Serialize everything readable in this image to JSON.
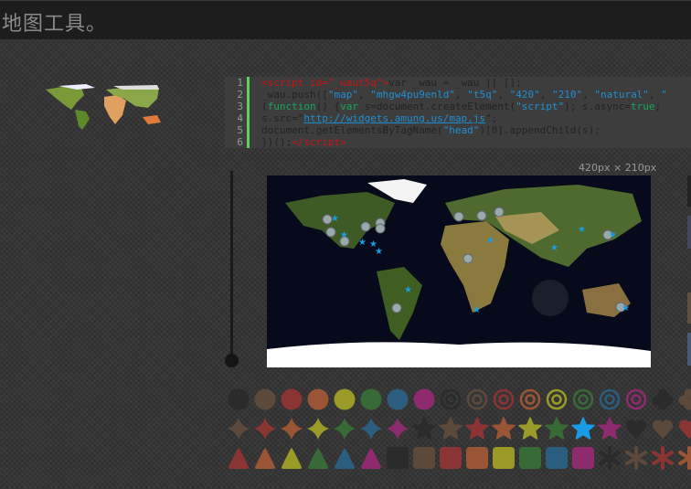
{
  "header": {
    "title": "地图工具。"
  },
  "code": {
    "line_numbers": [
      "1",
      "2",
      "3",
      "4",
      "5",
      "6"
    ],
    "l1_tag": "<script id=\"_waut5q\">",
    "l1_rest": "var _wau = _wau || [];",
    "l2_a": "_wau.push([",
    "l2_s1": "\"map\"",
    "l2_s2": "\"mhgw4pu9enld\"",
    "l2_s3": "\"t5q\"",
    "l2_s4": "\"420\"",
    "l2_s5": "\"210\"",
    "l2_s6": "\"natural\"",
    "l2_s7": "\"",
    "l3_kw1": "function",
    "l3_kw2": "var",
    "l3_a": " s=document.createElement(",
    "l3_s": "\"script\"",
    "l3_b": "); s.async=",
    "l3_kw3": "true",
    "l4_a": "s.src=",
    "l4_url": "http://widgets.amung.us/map.js",
    "l5_a": "document.getElementsByTagName(",
    "l5_s": "\"head\"",
    "l5_b": ")[0].appendChild(s);",
    "l6_a": "})();",
    "l6_tag": "</script>"
  },
  "preview": {
    "size_label": "420px × 210px"
  },
  "slider": {
    "value": 0
  },
  "colors": [
    "#2b2b2b",
    "#5b4a3c",
    "#8a3434",
    "#9a5535",
    "#9a9a28",
    "#386a38",
    "#2b5d7e",
    "#8e2a6e"
  ],
  "selected_marker": {
    "shape": "star",
    "color": "#1a9be6"
  },
  "marker_rows": [
    {
      "shape": "circle",
      "colors": [
        0,
        1,
        2,
        3,
        4,
        5,
        6,
        7
      ]
    },
    {
      "shape": "ring",
      "colors": [
        0,
        1,
        2,
        3,
        4,
        5,
        6,
        7
      ]
    },
    {
      "shape": "club",
      "colors": [
        0,
        1
      ]
    },
    {
      "shape": "diamond",
      "colors": [
        1,
        2,
        3,
        4,
        5,
        6,
        7
      ]
    },
    {
      "shape": "star",
      "colors": [
        0,
        1,
        2,
        3,
        4,
        5,
        "sel",
        7
      ]
    },
    {
      "shape": "heart",
      "colors": [
        0,
        1,
        2
      ]
    },
    {
      "shape": "triangle",
      "colors": [
        2,
        3,
        4,
        5,
        6,
        7
      ]
    },
    {
      "shape": "square",
      "colors": [
        0,
        1,
        2,
        3,
        4,
        5,
        6,
        7
      ]
    },
    {
      "shape": "asterisk",
      "colors": [
        0,
        1,
        2,
        3
      ]
    }
  ]
}
